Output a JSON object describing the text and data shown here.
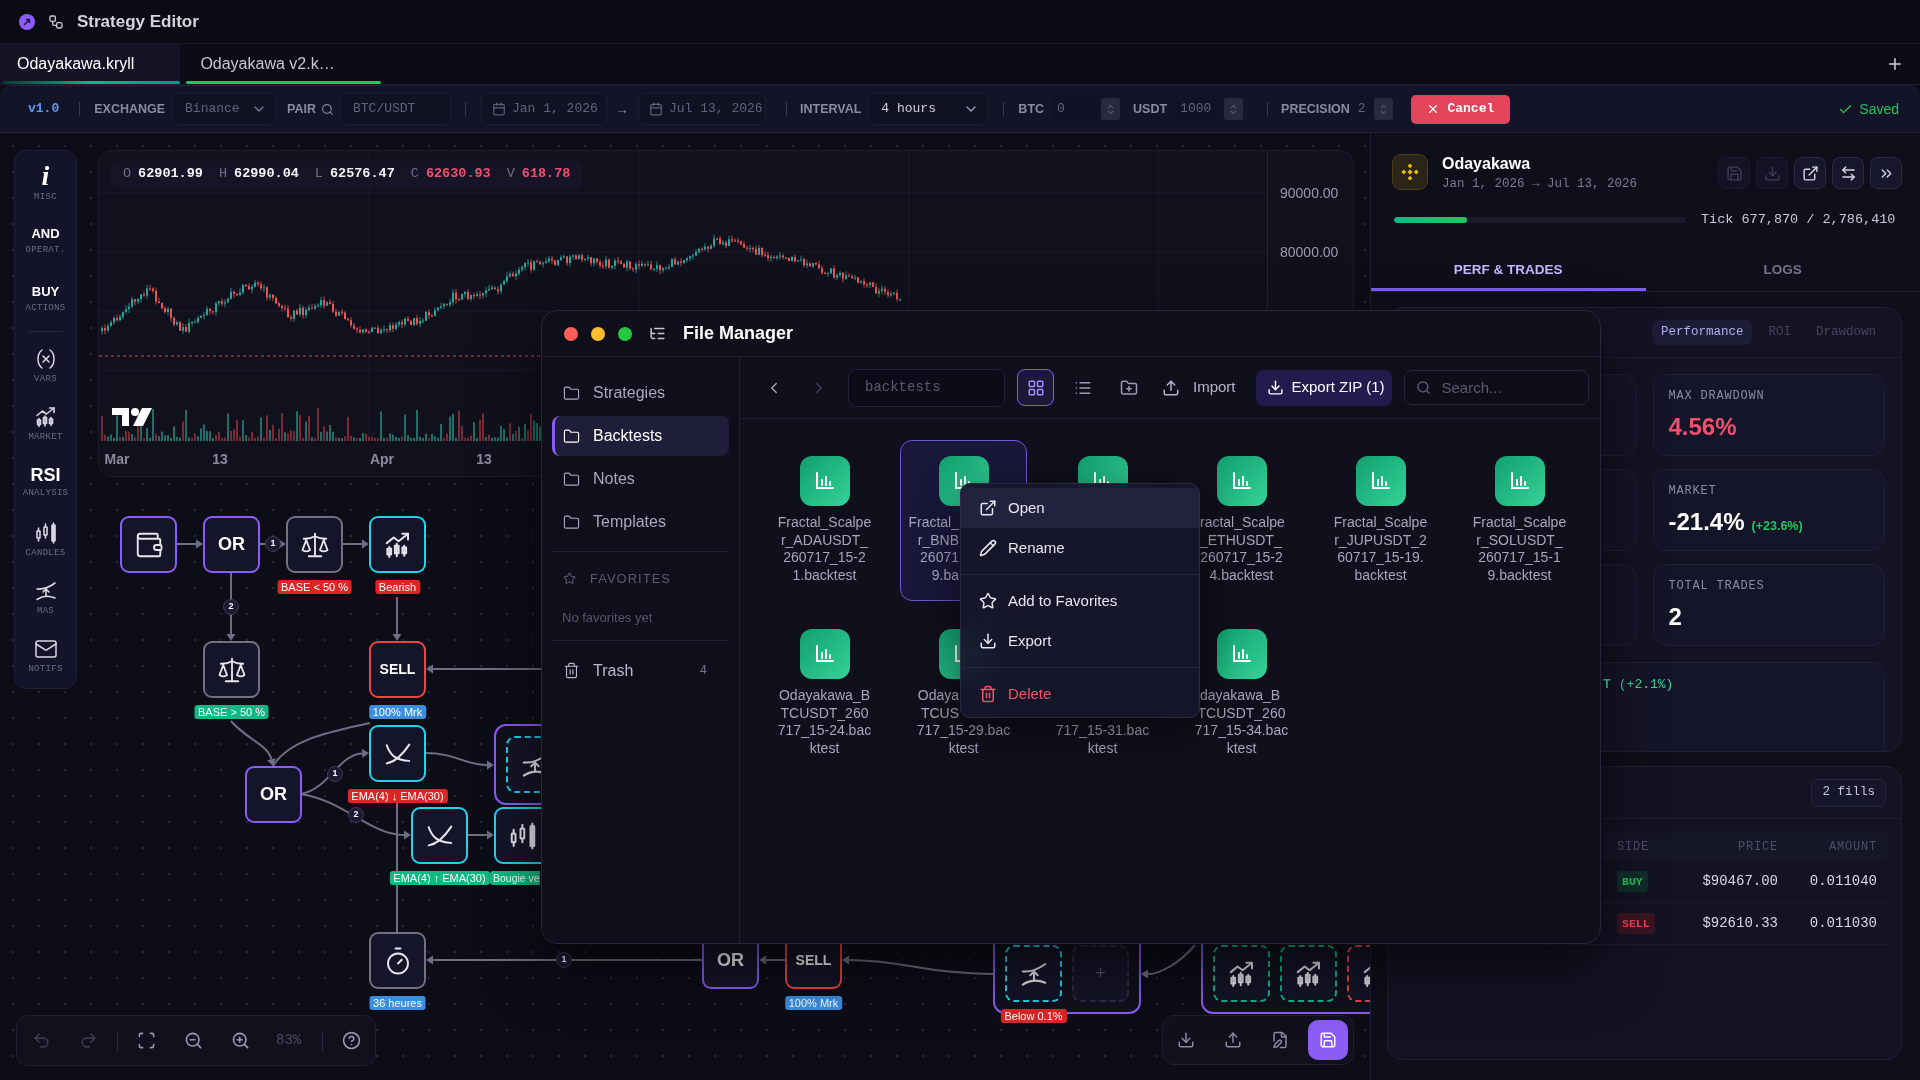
{
  "title_bar": {
    "title": "Strategy Editor"
  },
  "tabs": [
    {
      "label": "Odayakawa.kryll",
      "selected": true
    },
    {
      "label": "Odayakawa v2.k…",
      "selected": false
    }
  ],
  "toolbar": {
    "version": "v1.0",
    "exchange": {
      "label": "EXCHANGE",
      "value": "Binance",
      "disabled": true
    },
    "pair": {
      "label": "PAIR",
      "value": "BTC/USDT",
      "disabled": true
    },
    "date_from": {
      "value": "Jan 1, 2026",
      "disabled": true
    },
    "date_arrow": "→",
    "date_to": {
      "value": "Jul 13, 2026",
      "disabled": true
    },
    "interval": {
      "label": "INTERVAL",
      "value": "4 hours",
      "disabled": false
    },
    "balances": [
      {
        "label": "BTC",
        "value": "0",
        "disabled": true
      },
      {
        "label": "USDT",
        "value": "1000",
        "disabled": true
      }
    ],
    "precision": {
      "label": "PRECISION",
      "value": "2",
      "disabled": true
    },
    "cancel": "Cancel",
    "status": "Saved"
  },
  "palette": [
    {
      "kind": "glyph_italic",
      "glyph": "i",
      "label": "MISC"
    },
    {
      "kind": "word",
      "glyph": "AND",
      "label": "OPERAT."
    },
    {
      "kind": "word",
      "glyph": "BUY",
      "label": "ACTIONS"
    },
    {
      "kind": "vars",
      "label": "VARS"
    },
    {
      "kind": "market",
      "label": "MARKET"
    },
    {
      "kind": "word_large",
      "glyph": "RSI",
      "label": "ANALYSIS"
    },
    {
      "kind": "candles",
      "label": "CANDLES"
    },
    {
      "kind": "mas",
      "label": "MAS"
    },
    {
      "kind": "mail",
      "label": "NOTIFS"
    }
  ],
  "chart": {
    "ohlc": [
      {
        "label": "O",
        "value": "62901.99",
        "color": "#f4f4f8"
      },
      {
        "label": "H",
        "value": "62990.04",
        "color": "#f4f4f8"
      },
      {
        "label": "L",
        "value": "62576.47",
        "color": "#f4f4f8"
      },
      {
        "label": "C",
        "value": "62630.93",
        "color": "#f0506e"
      },
      {
        "label": "V",
        "value": "618.78",
        "color": "#f0506e"
      }
    ],
    "price_axis": [
      "90000.00",
      "80000.00"
    ],
    "time_axis": [
      "Mar",
      "13",
      "Apr",
      "13"
    ]
  },
  "canvas": {
    "nodes": [
      {
        "kind": "wallet"
      },
      {
        "kind": "or",
        "text": "OR"
      },
      {
        "kind": "balance",
        "tag": {
          "text": "BASE < 50 %",
          "color": "#dc2626"
        }
      },
      {
        "kind": "trend",
        "tag": {
          "text": "Bearish",
          "color": "#dc2626"
        }
      },
      {
        "kind": "balance",
        "tag": {
          "text": "BASE > 50 %",
          "color": "#10b981"
        }
      },
      {
        "kind": "sell",
        "text": "SELL",
        "tag": {
          "text": "100% Mrk",
          "color": "#3b8ee0"
        }
      },
      {
        "kind": "or",
        "text": "OR"
      },
      {
        "kind": "ema",
        "tag": {
          "text": "EMA(4) ↓ EMA(30)",
          "color": "#dc2626"
        }
      },
      {
        "kind": "group",
        "children": [
          {
            "kind": "mas"
          }
        ]
      },
      {
        "kind": "ema",
        "tag": {
          "text": "EMA(4) ↑ EMA(30)",
          "color": "#10b981"
        }
      },
      {
        "kind": "candles",
        "tag": {
          "kind": "clipped",
          "text": "Bougie ve",
          "color": "#10b981"
        }
      },
      {
        "kind": "timer",
        "tag": {
          "text": "36 heures",
          "color": "#3b8ee0"
        }
      },
      {
        "kind": "or",
        "text": "OR"
      },
      {
        "kind": "sell",
        "text": "SELL",
        "tag": {
          "text": "100% Mrk",
          "color": "#3b8ee0"
        }
      },
      {
        "kind": "group",
        "children": [
          {
            "kind": "mas",
            "tag": {
              "text": "Below 0.1%",
              "color": "#dc2626"
            }
          },
          {
            "kind": "add",
            "text": "+"
          }
        ]
      },
      {
        "kind": "group",
        "children": [
          {
            "kind": "market_up"
          },
          {
            "kind": "market_up"
          },
          {
            "kind": "market_down"
          }
        ]
      }
    ],
    "edge_badges": [
      "1",
      "2",
      "1",
      "2",
      "1"
    ],
    "view_controls": [
      [
        {
          "kind": "undo",
          "disabled": true
        },
        {
          "kind": "redo",
          "disabled": true
        }
      ],
      [
        {
          "kind": "fit",
          "disabled": false
        },
        {
          "kind": "zoom_out",
          "disabled": false
        },
        {
          "kind": "zoom_in",
          "disabled": false
        },
        {
          "kind": "zoom_value",
          "text": "83%",
          "disabled": true
        }
      ],
      [
        {
          "kind": "help",
          "disabled": false
        }
      ]
    ],
    "file_actions": [
      {
        "kind": "download"
      },
      {
        "kind": "upload"
      },
      {
        "kind": "edit"
      },
      {
        "kind": "save"
      }
    ]
  },
  "run_panel": {
    "name": "Odayakawa",
    "dates": "Jan 1, 2026 → Jul 13, 2026",
    "actions": [
      {
        "kind": "save",
        "disabled": true
      },
      {
        "kind": "download",
        "disabled": true
      },
      {
        "kind": "open",
        "disabled": false
      },
      {
        "kind": "swap",
        "disabled": false
      },
      {
        "kind": "collapse",
        "disabled": false
      }
    ],
    "progress": {
      "level": 0.25,
      "reading": "Tick 677,870 / 2,786,410"
    },
    "tabs": [
      {
        "label": "PERF & TRADES",
        "selected": true
      },
      {
        "label": "LOGS",
        "selected": false
      }
    ],
    "views": [
      {
        "label": "Performance",
        "selected": true
      },
      {
        "label": "ROI",
        "selected": false
      },
      {
        "label": "Drawdown",
        "selected": false
      }
    ],
    "metrics": [
      {
        "kind": "negative",
        "label": "MAX DRAWDOWN",
        "value": "4.56%"
      },
      {
        "kind": "neutral",
        "label": "MARKET",
        "value": "-21.4%",
        "change": "(+23.6%)"
      },
      {
        "kind": "neutral",
        "label": "TOTAL TRADES",
        "value": "2"
      }
    ],
    "equity": {
      "value": "T",
      "change": "(+2.1%)"
    },
    "trades": {
      "count": "2 fills",
      "columns": [
        "SIDE",
        "PRICE",
        "AMOUNT"
      ],
      "rows": [
        {
          "kind": "buy",
          "side": "BUY",
          "price": "$90467.00",
          "amount": "0.011040"
        },
        {
          "kind": "sell",
          "side": "SELL",
          "price": "$92610.33",
          "amount": "0.011030"
        }
      ]
    }
  },
  "file_manager": {
    "title": "File Manager",
    "places": [
      {
        "label": "Strategies",
        "selected": false
      },
      {
        "label": "Backtests",
        "selected": true
      },
      {
        "label": "Notes",
        "selected": false
      },
      {
        "label": "Templates",
        "selected": false
      }
    ],
    "favorites": {
      "heading": "FAVORITES",
      "empty": "No favorites yet"
    },
    "trash": {
      "label": "Trash",
      "count": "4"
    },
    "nav": [
      {
        "kind": "back",
        "disabled": false
      },
      {
        "kind": "forward",
        "disabled": true
      }
    ],
    "path": "backtests",
    "views": [
      {
        "kind": "grid",
        "selected": true
      },
      {
        "kind": "list",
        "selected": false
      }
    ],
    "actions": [
      {
        "kind": "new_folder"
      },
      {
        "kind": "import",
        "label": "Import"
      },
      {
        "kind": "export",
        "label": "Export ZIP (1)"
      }
    ],
    "search": {
      "placeholder": "Search..."
    },
    "files": [
      {
        "kind": "file",
        "selected": false,
        "name": [
          {
            "kind": "whole",
            "lines": [
              "Fractal_Scalpe",
              "r_ADAUSDT_",
              "260717_15-2",
              "1.backtest"
            ]
          }
        ]
      },
      {
        "kind": "file",
        "selected": true,
        "name": [
          {
            "kind": "clipped_right",
            "lines": [
              "Fractal_",
              "r_BNB",
              "26071",
              "9.ba"
            ]
          }
        ]
      },
      {
        "kind": "file",
        "selected": false
      },
      {
        "kind": "file",
        "selected": false,
        "name": [
          {
            "kind": "clipped_left",
            "lines": [
              "ractal_Scalpe",
              "_ETHUSDT_"
            ]
          },
          {
            "kind": "whole",
            "lines": [
              "260717_15-2",
              "4.backtest"
            ]
          }
        ]
      },
      {
        "kind": "file",
        "selected": false,
        "name": [
          {
            "kind": "whole",
            "lines": [
              "Fractal_Scalpe",
              "r_JUPUSDT_2",
              "60717_15-19.",
              "backtest"
            ]
          }
        ]
      },
      {
        "kind": "file",
        "selected": false,
        "name": [
          {
            "kind": "whole",
            "lines": [
              "Fractal_Scalpe",
              "r_SOLUSDT_",
              "260717_15-1",
              "9.backtest"
            ]
          }
        ]
      },
      {
        "kind": "file",
        "selected": false,
        "name": [
          {
            "kind": "whole",
            "lines": [
              "Odayakawa_B",
              "TCUSDT_260",
              "717_15-24.bac",
              "ktest"
            ]
          }
        ]
      },
      {
        "kind": "file",
        "selected": false,
        "name": [
          {
            "kind": "clipped_right",
            "lines": [
              "Odaya",
              "TCUS"
            ]
          },
          {
            "kind": "whole",
            "lines": [
              "717_15-29.bac",
              "ktest"
            ]
          }
        ]
      },
      {
        "kind": "covered",
        "selected": false,
        "name": [
          {
            "kind": "whole",
            "lines": [
              "717_15-31.bac",
              "ktest"
            ]
          }
        ]
      },
      {
        "kind": "file",
        "selected": false,
        "name": [
          {
            "kind": "clipped_left",
            "lines": [
              "dayakawa_B"
            ]
          },
          {
            "kind": "whole",
            "lines": [
              "TCUSDT_260",
              "717_15-34.bac",
              "ktest"
            ]
          }
        ]
      }
    ],
    "context_menu": [
      [
        {
          "kind": "open",
          "label": "Open",
          "highlighted": true
        },
        {
          "kind": "rename",
          "label": "Rename",
          "highlighted": false
        }
      ],
      [
        {
          "kind": "favorite",
          "label": "Add to Favorites",
          "highlighted": false
        },
        {
          "kind": "export",
          "label": "Export",
          "highlighted": false
        }
      ],
      [
        {
          "kind": "delete",
          "label": "Delete",
          "highlighted": false
        }
      ]
    ]
  }
}
